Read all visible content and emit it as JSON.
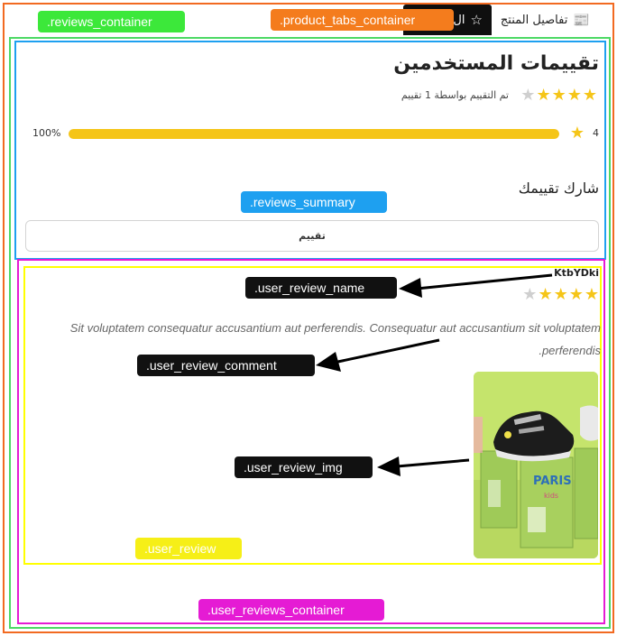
{
  "tabs": [
    {
      "label": "تفاصيل المنتج",
      "icon": "document-icon"
    },
    {
      "label": "ال",
      "icon": "star-outline-icon"
    }
  ],
  "annotation_tags": {
    "reviews_container": ".reviews_container",
    "product_tabs_container": ".product_tabs_container",
    "reviews_summary": ".reviews_summary",
    "user_review_name": ".user_review_name",
    "user_review_comment": ".user_review_comment",
    "user_review_img": ".user_review_img",
    "user_review": ".user_review",
    "user_reviews_container": ".user_reviews_container"
  },
  "summary": {
    "title": "تقييمات المستخدمين",
    "rated_by": "تم التقييم بواسطة 1 تقييم",
    "stars_filled": 4,
    "stars_total": 5,
    "breakdown": [
      {
        "stars": "4",
        "percent_value": 100,
        "percent_label": "100%"
      }
    ],
    "share_label": "شارك تقييمك",
    "rate_button": "تقييم"
  },
  "review": {
    "name": "KtbYDki",
    "stars_filled": 4,
    "stars_total": 5,
    "comment": "Sit voluptatem consequatur accusantium aut perferendis. Consequatur aut accusantium sit voluptatem perferendis.",
    "image_alt": "kids sneaker on shoe boxes"
  },
  "colors": {
    "star": "#f5c518",
    "outline_orange": "#f26a21",
    "outline_green": "#4cd964",
    "outline_blue": "#1ea0f0",
    "outline_magenta": "#e51bd4",
    "outline_yellow": "#ffff00"
  }
}
